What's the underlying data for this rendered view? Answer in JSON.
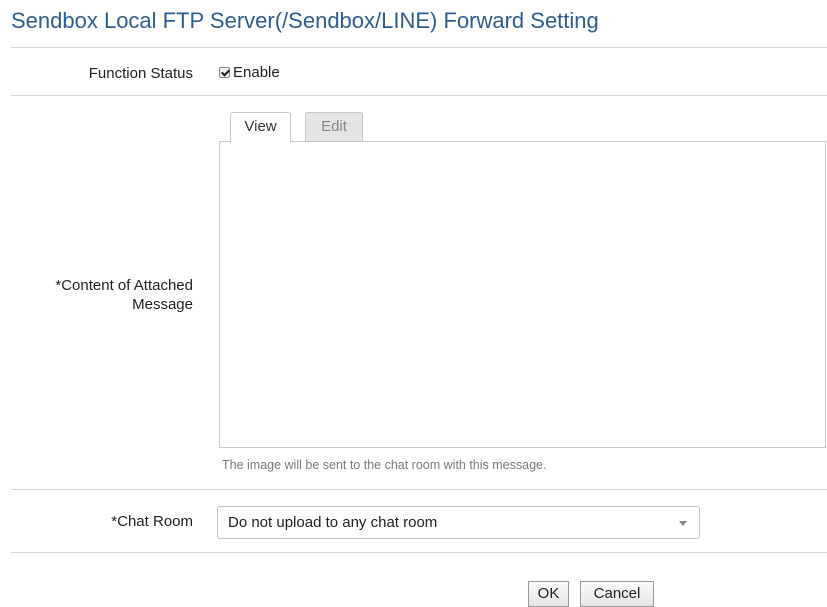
{
  "page": {
    "title": "Sendbox Local FTP Server(/Sendbox/LINE) Forward Setting"
  },
  "function_status": {
    "label": "Function Status",
    "checkbox_label": "Enable",
    "checked": true
  },
  "content": {
    "label_line1": "*Content of Attached",
    "label_line2": "Message",
    "tabs": [
      {
        "label": "View",
        "active": true
      },
      {
        "label": "Edit",
        "active": false
      }
    ],
    "message": "",
    "hint": "The image will be sent to the chat room with this message."
  },
  "chat_room": {
    "label": "*Chat Room",
    "selected": "Do not upload to any chat room"
  },
  "buttons": {
    "ok": "OK",
    "cancel": "Cancel"
  },
  "colors": {
    "title": "#2e5f8f",
    "divider": "#d6d6d6",
    "tab_inactive_bg": "#e4e4e4"
  }
}
